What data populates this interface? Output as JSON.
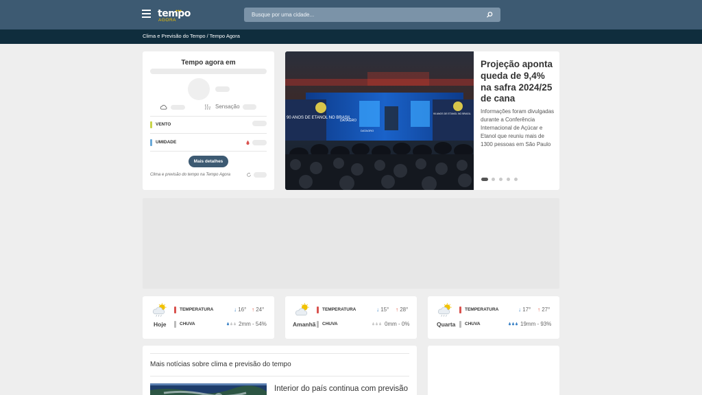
{
  "header": {
    "logo_text": "tempo",
    "logo_subtext": "AGORA",
    "search_placeholder": "Busque por uma cidade...",
    "icons": [
      "menu-icon",
      "search-icon"
    ]
  },
  "breadcrumb": "Clima e Previsão do Tempo / Tempo Agora",
  "current_weather": {
    "title": "Tempo agora em",
    "sensation_label": "Sensação",
    "wind_label": "VENTO",
    "humidity_label": "UMIDADE",
    "details_button": "Mais detalhes",
    "footer": "Clima e previsão do tempo na Tempo Agora"
  },
  "featured_news": {
    "title": "Projeção aponta queda de 9,4% na safra 2024/25 de cana",
    "summary": "Informações foram divulgadas durante a Conferência Internacional de Açúcar e Etanol que reuniu mais de 1300 pessoas em São Paulo",
    "carousel_count": 5,
    "carousel_active": 0,
    "image_texts": [
      "90 ANOS DE ETANOL NO BRASIL",
      "DATAGRO",
      "DATAGRO",
      "90 ANOS DE ETANOL NO BRASIL"
    ]
  },
  "forecast": {
    "temp_label": "TEMPERATURA",
    "rain_label": "CHUVA",
    "days": [
      {
        "day": "Hoje",
        "min": "16°",
        "max": "24°",
        "rain": "2mm - 54%",
        "icon": "sun-cloud-rain-icon"
      },
      {
        "day": "Amanhã",
        "min": "15°",
        "max": "28°",
        "rain": "0mm - 0%",
        "icon": "sun-cloud-icon"
      },
      {
        "day": "Quarta",
        "min": "17°",
        "max": "27°",
        "rain": "19mm - 93%",
        "icon": "sun-cloud-rain-icon"
      }
    ]
  },
  "more_news": {
    "heading": "Mais notícias sobre clima e previsão do tempo",
    "first_article_title": "Interior do país continua com previsão"
  },
  "colors": {
    "header": "#3d5a72",
    "breadcrumb_bar": "#0f2d3d",
    "accent_yellow": "#f2c200",
    "temp_bar": "#d9534f",
    "humidity_bar": "#6aa9d8",
    "wind_bar": "#c8d44a"
  }
}
